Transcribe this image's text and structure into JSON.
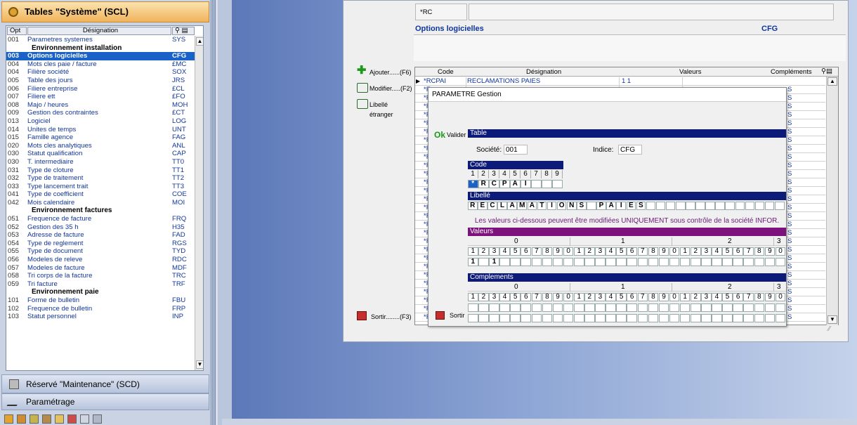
{
  "left": {
    "title": "Tables \"Système\" (SCL)",
    "header": {
      "opt": "Opt",
      "designation": "Désignation"
    },
    "rows": [
      {
        "code": "001",
        "label": "Parametres systemes",
        "key": "SYS"
      },
      {
        "code": "",
        "label": "Environnement installation",
        "key": "",
        "section": true
      },
      {
        "code": "003",
        "label": "Options logicielles",
        "key": "CFG",
        "selected": true
      },
      {
        "code": "004",
        "label": "Mots cles paie / facture",
        "key": "£MC"
      },
      {
        "code": "004",
        "label": "Filière société",
        "key": "SOX"
      },
      {
        "code": "005",
        "label": "Table des jours",
        "key": "JRS"
      },
      {
        "code": "006",
        "label": "Filiere entreprise",
        "key": "£CL"
      },
      {
        "code": "007",
        "label": "Filiere ett",
        "key": "£FO"
      },
      {
        "code": "008",
        "label": "Majo / heures",
        "key": "MOH"
      },
      {
        "code": "009",
        "label": "Gestion des contraintes",
        "key": "£CT"
      },
      {
        "code": "013",
        "label": "Logiciel",
        "key": "LOG"
      },
      {
        "code": "014",
        "label": "Unites de temps",
        "key": "UNT"
      },
      {
        "code": "015",
        "label": "Famille agence",
        "key": "FAG"
      },
      {
        "code": "020",
        "label": "Mots cles analytiques",
        "key": "ANL"
      },
      {
        "code": "030",
        "label": "Statut qualification",
        "key": "CAP"
      },
      {
        "code": "030",
        "label": "T. intermediaire",
        "key": "TT0"
      },
      {
        "code": "031",
        "label": "Type de cloture",
        "key": "TT1"
      },
      {
        "code": "032",
        "label": "Type de traitement",
        "key": "TT2"
      },
      {
        "code": "033",
        "label": "Type lancement trait",
        "key": "TT3"
      },
      {
        "code": "041",
        "label": "Type de coefficient",
        "key": "COE"
      },
      {
        "code": "042",
        "label": "Mois calendaire",
        "key": "MOI"
      },
      {
        "code": "",
        "label": "Environnement factures",
        "key": "",
        "section": true
      },
      {
        "code": "051",
        "label": "Frequence de facture",
        "key": "FRQ"
      },
      {
        "code": "052",
        "label": "Gestion des 35 h",
        "key": "H35"
      },
      {
        "code": "053",
        "label": "Adresse de facture",
        "key": "FAD"
      },
      {
        "code": "054",
        "label": "Type de reglement",
        "key": "RGS"
      },
      {
        "code": "055",
        "label": "Type de document",
        "key": "TYD"
      },
      {
        "code": "056",
        "label": "Modeles de releve",
        "key": "RDC"
      },
      {
        "code": "057",
        "label": "Modeles de facture",
        "key": "MDF"
      },
      {
        "code": "058",
        "label": "Tri corps de la facture",
        "key": "TRC"
      },
      {
        "code": "059",
        "label": "Tri facture",
        "key": "TRF"
      },
      {
        "code": "",
        "label": "Environnement paie",
        "key": "",
        "section": true
      },
      {
        "code": "101",
        "label": "Forme de bulletin",
        "key": "FBU"
      },
      {
        "code": "102",
        "label": "Frequence de bulletin",
        "key": "FRP"
      },
      {
        "code": "103",
        "label": "Statut personnel",
        "key": "INP"
      }
    ],
    "bottom1": "Réservé \"Maintenance\" (SCD)",
    "bottom2": "Paramétrage"
  },
  "main": {
    "rc_value": "*RC",
    "section_title": "Options logicielles",
    "section_code": "CFG",
    "buttons": {
      "add": "Ajouter......(F6)",
      "modify": "Modifier.....(F2)",
      "foreign": "Libellé étranger",
      "exit": "Sortir........(F3)"
    },
    "grid": {
      "headers": {
        "code": "Code",
        "designation": "Désignation",
        "values": "Valeurs",
        "complements": "Compléments"
      },
      "first_row": {
        "code": "*RCPAI",
        "designation": "RECLAMATIONS PAIES",
        "values": "1 1"
      },
      "row_prefix": "*F",
      "row_suffix": "S"
    }
  },
  "dialog": {
    "title": "PARAMETRE Gestion",
    "ok_label": "Ok",
    "valider": "Valider",
    "sortir": "Sortir",
    "table_band": "Table",
    "societe_label": "Société:",
    "societe_value": "001",
    "indice_label": "Indice:",
    "indice_value": "CFG",
    "code_band": "Code",
    "code_digits": [
      "1",
      "2",
      "3",
      "4",
      "5",
      "6",
      "7",
      "8",
      "9"
    ],
    "code_letters": [
      "*",
      "R",
      "C",
      "P",
      "A",
      "I",
      "",
      "",
      ""
    ],
    "libelle_band": "Libellé",
    "libelle_letters": [
      "R",
      "E",
      "C",
      "L",
      "A",
      "M",
      "A",
      "T",
      "I",
      "O",
      "N",
      "S",
      "",
      "P",
      "A",
      "I",
      "E",
      "S",
      "",
      "",
      "",
      "",
      "",
      "",
      "",
      "",
      "",
      "",
      "",
      "",
      "",
      ""
    ],
    "warning": "Les valeurs ci-dessous peuvent être modifiées UNIQUEMENT sous contrôle de la société INFOR.",
    "valeurs_band": "Valeurs",
    "tens": [
      "0",
      "1",
      "2",
      "3"
    ],
    "digits": [
      "1",
      "2",
      "3",
      "4",
      "5",
      "6",
      "7",
      "8",
      "9",
      "0",
      "1",
      "2",
      "3",
      "4",
      "5",
      "6",
      "7",
      "8",
      "9",
      "0",
      "1",
      "2",
      "3",
      "4",
      "5",
      "6",
      "7",
      "8",
      "9",
      "0"
    ],
    "valeurs_values": [
      "1",
      "",
      "1",
      "",
      "",
      "",
      "",
      "",
      "",
      "",
      "",
      "",
      "",
      "",
      "",
      "",
      "",
      "",
      "",
      "",
      "",
      "",
      "",
      "",
      "",
      "",
      "",
      "",
      "",
      ""
    ],
    "complements_band": "Complements"
  }
}
